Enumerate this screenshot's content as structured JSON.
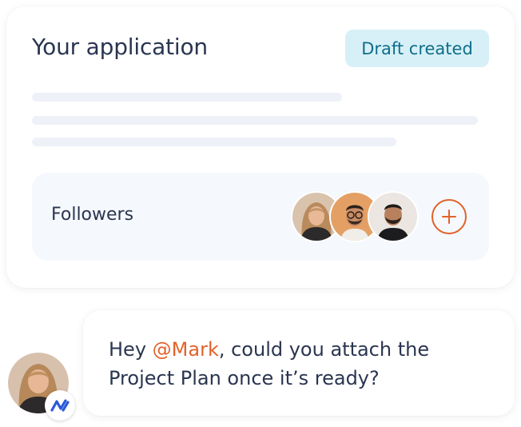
{
  "application_card": {
    "title": "Your application",
    "status_badge": "Draft created",
    "followers": {
      "label": "Followers",
      "avatars": [
        "avatar-woman-icon",
        "avatar-man-glasses-icon",
        "avatar-man-beard-icon"
      ],
      "add_icon": "plus-circle-icon"
    }
  },
  "comment": {
    "greeting": "Hey ",
    "mention": "@Mark",
    "message": ", could you attach the Project Plan once it’s ready?",
    "commenter_avatar": "avatar-woman-icon",
    "app_badge_icon": "app-logo-icon"
  },
  "colors": {
    "title_text": "#2a3550",
    "badge_bg": "#d7f0f8",
    "badge_text": "#0e6e88",
    "accent": "#e2622a",
    "panel_bg": "#f5f8fc",
    "skeleton": "#eef1f7",
    "logo_blue": "#2b5bd7"
  }
}
